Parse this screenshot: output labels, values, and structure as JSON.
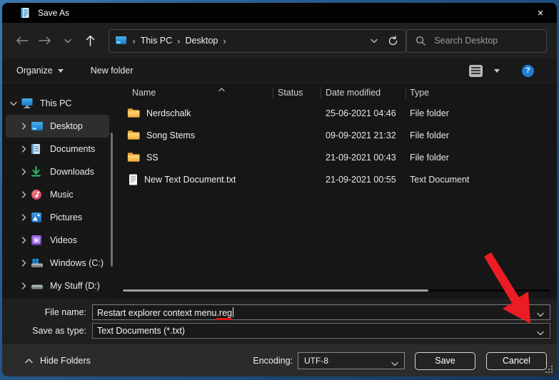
{
  "window": {
    "title": "Save As"
  },
  "titlebar": {
    "close_glyph": "×"
  },
  "nav": {
    "breadcrumb": [
      "This PC",
      "Desktop"
    ],
    "separator": "›",
    "search_placeholder": "Search Desktop"
  },
  "toolbar": {
    "organize_label": "Organize",
    "new_folder_label": "New folder",
    "help_glyph": "?"
  },
  "sidebar": {
    "items": [
      {
        "label": "This PC"
      },
      {
        "label": "Desktop"
      },
      {
        "label": "Documents"
      },
      {
        "label": "Downloads"
      },
      {
        "label": "Music"
      },
      {
        "label": "Pictures"
      },
      {
        "label": "Videos"
      },
      {
        "label": "Windows (C:)"
      },
      {
        "label": "My Stuff (D:)"
      }
    ]
  },
  "file_list": {
    "columns": [
      "Name",
      "Status",
      "Date modified",
      "Type"
    ],
    "rows": [
      {
        "name": "Nerdschalk",
        "status": "",
        "date_modified": "25-06-2021 04:46",
        "type": "File folder",
        "icon": "folder-icon"
      },
      {
        "name": "Song Stems",
        "status": "",
        "date_modified": "09-09-2021 21:32",
        "type": "File folder",
        "icon": "folder-icon"
      },
      {
        "name": "SS",
        "status": "",
        "date_modified": "21-09-2021 00:43",
        "type": "File folder",
        "icon": "folder-icon"
      },
      {
        "name": "New Text Document.txt",
        "status": "",
        "date_modified": "21-09-2021 00:55",
        "type": "Text Document",
        "icon": "text-file-icon"
      }
    ]
  },
  "fields": {
    "file_name_label": "File name:",
    "file_name_value": "Restart explorer context menu.reg",
    "file_name_value_main": "Restart explorer context menu",
    "file_name_value_underlined_ext": ".reg",
    "save_as_type_label": "Save as type:",
    "save_as_type_value": "Text Documents (*.txt)"
  },
  "footer": {
    "hide_folders_label": "Hide Folders",
    "encoding_label": "Encoding:",
    "encoding_value": "UTF-8",
    "save_label": "Save",
    "cancel_label": "Cancel"
  },
  "colors": {
    "help_accent": "#1d7fd7",
    "folder_yellow": "#f6c64f",
    "annotation_red": "#ec1c24",
    "selection_gray": "#2e2e2e",
    "titlebar_black": "#030303"
  }
}
